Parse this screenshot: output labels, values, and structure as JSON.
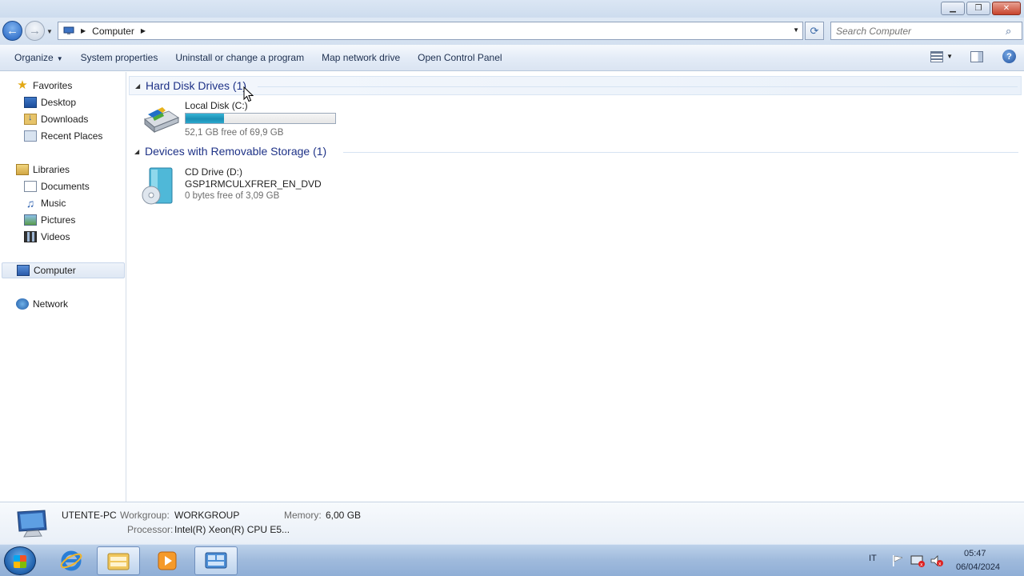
{
  "window": {
    "minimize_icon": "minimize-icon",
    "maximize_icon": "restore-icon",
    "close_icon": "close-icon"
  },
  "address_bar": {
    "breadcrumb": [
      "Computer"
    ],
    "search_placeholder": "Search Computer"
  },
  "command_bar": {
    "items": [
      "Organize",
      "System properties",
      "Uninstall or change a program",
      "Map network drive",
      "Open Control Panel"
    ]
  },
  "nav_pane": {
    "favorites": {
      "label": "Favorites",
      "items": [
        "Desktop",
        "Downloads",
        "Recent Places"
      ]
    },
    "libraries": {
      "label": "Libraries",
      "items": [
        "Documents",
        "Music",
        "Pictures",
        "Videos"
      ]
    },
    "computer": "Computer",
    "network": "Network"
  },
  "content": {
    "hard_disk_group": "Hard Disk Drives (1)",
    "local_disk": {
      "name": "Local Disk (C:)",
      "free_text": "52,1 GB free of 69,9 GB",
      "used_fraction": 0.255
    },
    "removable_group": "Devices with Removable Storage (1)",
    "cd_drive": {
      "name": "CD Drive (D:)",
      "label": "GSP1RMCULXFRER_EN_DVD",
      "free_text": "0 bytes free of 3,09 GB"
    }
  },
  "details_pane": {
    "computer_name": "UTENTE-PC",
    "workgroup_label": "Workgroup:",
    "workgroup_value": "WORKGROUP",
    "memory_label": "Memory:",
    "memory_value": "6,00 GB",
    "processor_label": "Processor:",
    "processor_value": "Intel(R) Xeon(R) CPU E5..."
  },
  "taskbar": {
    "language": "IT",
    "time": "05:47",
    "date": "06/04/2024"
  },
  "colors": {
    "group_title": "#1e3287",
    "disk_bar": "#1b8fb5",
    "taskbar": "#9fbadc"
  }
}
